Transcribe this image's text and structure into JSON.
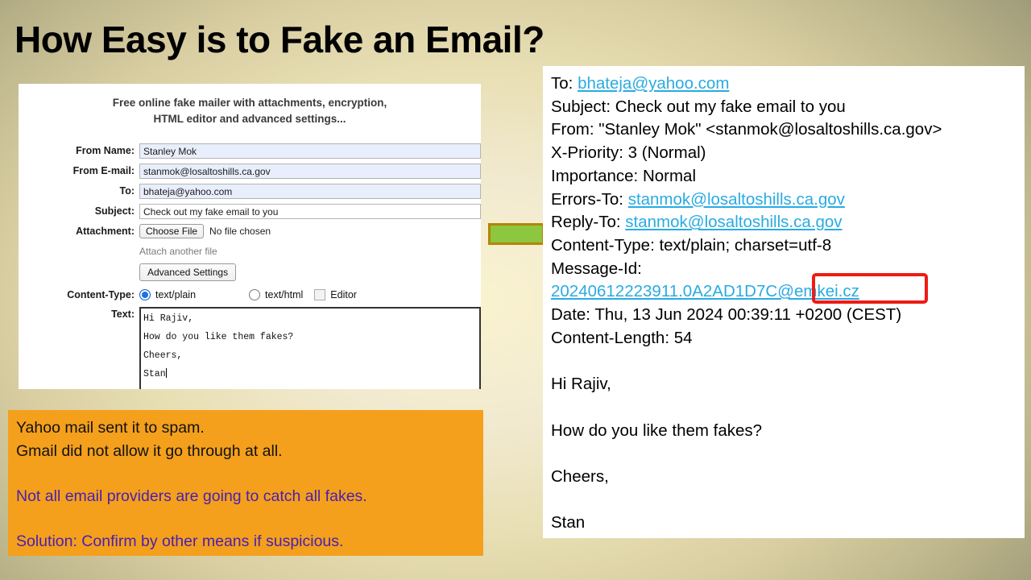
{
  "slide": {
    "title": "How Easy is to Fake an Email?",
    "background_edge_color": "#9c9878",
    "background_center_color": "#faf3cf"
  },
  "connector": {
    "name": "green-arrow-connector",
    "fill": "#8dc63f",
    "border": "#b58500"
  },
  "fake_mailer_form": {
    "heading_line1": "Free online fake mailer with attachments, encryption,",
    "heading_line2": "HTML editor and advanced settings...",
    "fields": [
      {
        "label": "From Name:",
        "value": "Stanley Mok"
      },
      {
        "label": "From E-mail:",
        "value": "stanmok@losaltoshills.ca.gov"
      },
      {
        "label": "To:",
        "value": "bhateja@yahoo.com"
      },
      {
        "label": "Subject:",
        "value": "Check out my fake email to you"
      }
    ],
    "attachment_label": "Attachment:",
    "choose_file_button": "Choose File",
    "no_file_chosen": "No file chosen",
    "attach_another_file": "Attach another file",
    "advanced_settings_button": "Advanced Settings",
    "content_type_label": "Content-Type:",
    "content_type_plain": "text/plain",
    "content_type_html": "text/html",
    "editor_checkbox": "Editor",
    "text_label": "Text:",
    "text_body_lines": [
      "Hi Rajiv,",
      "",
      "How do you like them fakes?",
      "",
      "Cheers,",
      "",
      "Stan"
    ]
  },
  "email_headers": {
    "to_label": "To:",
    "to_value": "bhateja@yahoo.com",
    "subject": "Subject: Check out my fake email to you",
    "from": "From: \"Stanley Mok\" <stanmok@losaltoshills.ca.gov>",
    "x_priority": "X-Priority: 3 (Normal)",
    "importance": "Importance: Normal",
    "errors_to_label": "Errors-To:",
    "errors_to_value": "stanmok@losaltoshills.ca.gov",
    "reply_to_label": "Reply-To:",
    "reply_to_value": "stanmok@losaltoshills.ca.gov",
    "content_type": "Content-Type: text/plain; charset=utf-8",
    "message_id_label": "Message-Id:",
    "message_id_value": "20240612223911.0A2AD1D7C@emkei.cz",
    "message_id_highlighted_part": "@emkei.cz",
    "date": "Date: Thu, 13 Jun 2024 00:39:11 +0200 (CEST)",
    "content_length": "Content-Length: 54",
    "highlight_color": "#ee1b12",
    "link_color": "#29abe2",
    "body_lines": [
      "Hi Rajiv,",
      "How do you like them fakes?",
      "Cheers,",
      "Stan"
    ]
  },
  "callout": {
    "background": "#f4a01c",
    "line1": "Yahoo mail sent it to spam.",
    "line2": "Gmail did not allow it go through at all.",
    "line3": "Not all email providers are going to catch all fakes.",
    "line4": "Solution: Confirm by other means if suspicious.",
    "emphasis_color": "#4a20b0"
  }
}
